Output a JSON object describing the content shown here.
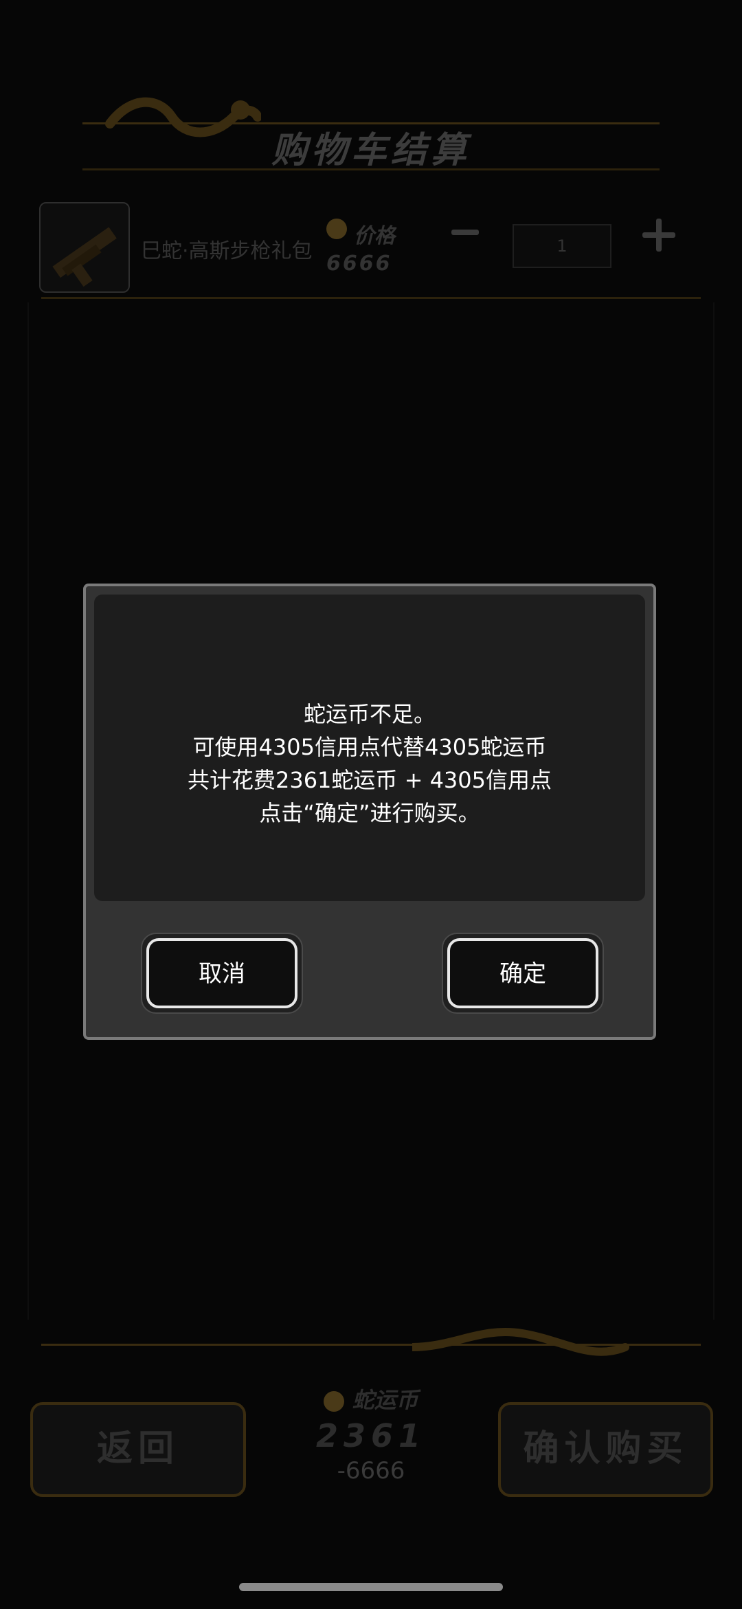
{
  "page": {
    "title": "购物车结算"
  },
  "cart": {
    "items": [
      {
        "name": "巳蛇·高斯步枪礼包",
        "price_label": "价格",
        "price": "6666",
        "quantity": "1"
      }
    ]
  },
  "footer": {
    "back_label": "返回",
    "confirm_label": "确认购买",
    "currency_label": "蛇运币",
    "currency_value": "2361",
    "currency_delta": "-6666"
  },
  "dialog": {
    "lines": [
      "蛇运币不足。",
      "可使用4305信用点代替4305蛇运币",
      "共计花费2361蛇运币 + 4305信用点",
      "点击“确定”进行购买。"
    ],
    "cancel_label": "取消",
    "ok_label": "确定"
  },
  "colors": {
    "gold_dim": "#3a2c10",
    "dialog_border": "#7a7a7a",
    "dialog_bg": "#333333"
  }
}
